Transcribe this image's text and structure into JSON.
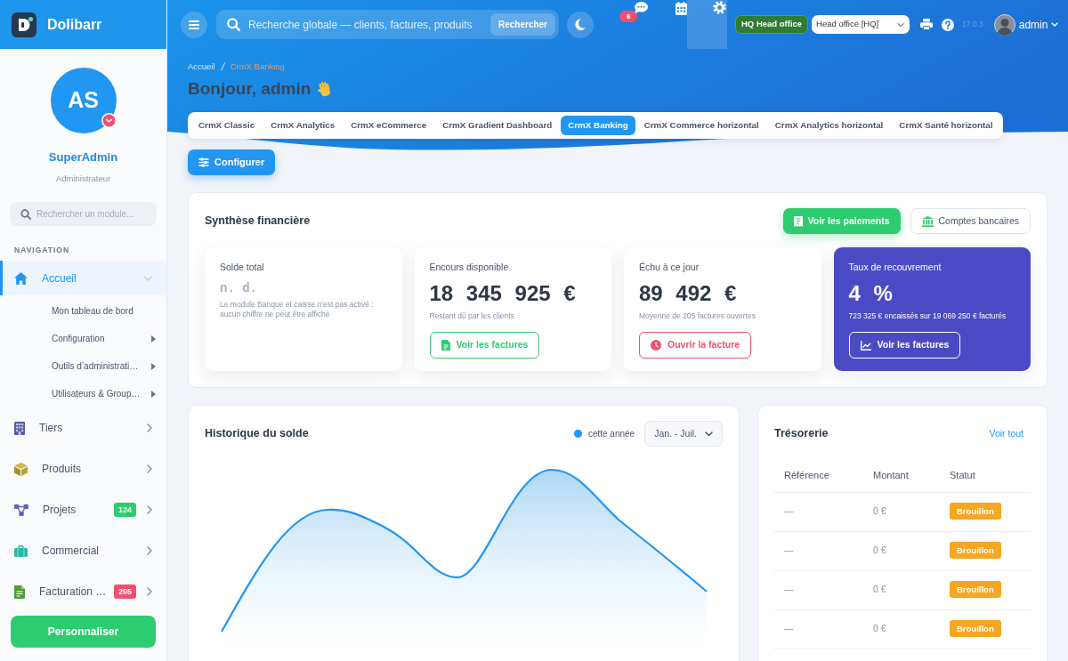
{
  "sidebar": {
    "brand": "Dolibarr",
    "profile": {
      "initials": "AS",
      "name": "SuperAdmin",
      "role": "Administrateur"
    },
    "search": {
      "placeholder": "Rechercher un module..."
    },
    "section": "NAVIGATION",
    "items": [
      {
        "label": "Accueil",
        "selected": true,
        "expanded": true,
        "children": [
          {
            "label": "Mon tableau de bord",
            "submenu": false
          },
          {
            "label": "Configuration",
            "submenu": true
          },
          {
            "label": "Outils d’administrati…",
            "submenu": true
          },
          {
            "label": "Utilisateurs & Group…",
            "submenu": true
          }
        ]
      },
      {
        "label": "Tiers",
        "selected": false,
        "expanded": false
      },
      {
        "label": "Produits",
        "selected": false,
        "expanded": false
      },
      {
        "label": "Projets",
        "selected": false,
        "expanded": false,
        "badge": {
          "text": "124",
          "color": "#2ecc71"
        }
      },
      {
        "label": "Commercial",
        "selected": false,
        "expanded": false
      },
      {
        "label": "Facturation …",
        "selected": false,
        "expanded": false,
        "badge": {
          "text": "205",
          "color": "#f0506e"
        }
      }
    ],
    "button": "Personnaliser"
  },
  "topbar": {
    "search": {
      "placeholder": "Recherche globale — clients, factures, produits",
      "button": "Rechercher"
    },
    "messages_count": "6",
    "entity": "HQ Head office",
    "entity_select": "Head office [HQ]",
    "version": "17.0.3",
    "user": "admin"
  },
  "header": {
    "breadcrumb": [
      "Accueil",
      "CrmX Banking"
    ],
    "greeting": "Bonjour, admin",
    "tabs": [
      {
        "label": "CrmX Classic",
        "selected": false
      },
      {
        "label": "CrmX Analytics",
        "selected": false
      },
      {
        "label": "CrmX eCommerce",
        "selected": false
      },
      {
        "label": "CrmX Gradient Dashboard",
        "selected": false
      },
      {
        "label": "CrmX Banking",
        "selected": true
      },
      {
        "label": "CrmX Commerce horizontal",
        "selected": false
      },
      {
        "label": "CrmX Analytics horizontal",
        "selected": false
      },
      {
        "label": "CrmX Santé horizontal",
        "selected": false
      }
    ],
    "configure_button": "Configurer"
  },
  "financial_summary": {
    "title": "Synthèse financière",
    "actions": [
      {
        "label": "Voir les paiements",
        "kind": "solid"
      },
      {
        "label": "Comptes bancaires",
        "kind": "outline"
      }
    ],
    "cards": [
      {
        "kind": "unavailable",
        "title": "Solde total",
        "value": "n. d.",
        "note": "Le module Banque et caisse n'est pas activé : aucun chiffre ne peut être affiché"
      },
      {
        "kind": "metric",
        "title": "Encours disponible",
        "value": "18 345 925 €",
        "note": "Restant dû par les clients",
        "button": {
          "label": "Voir les factures",
          "color": "#2ecc71"
        }
      },
      {
        "kind": "metric",
        "title": "Échu à ce jour",
        "value": "89 492 €",
        "note": "Moyenne de 205 factures ouvertes",
        "button": {
          "label": "Ouvrir la facture",
          "color": "#f0506e"
        }
      },
      {
        "kind": "featured",
        "title": "Taux de recouvrement",
        "value": "4 %",
        "note": "723 325 € encaissés sur 19 069 250 € facturés",
        "button": {
          "label": "Voir les factures",
          "color": "#ffffff"
        }
      }
    ]
  },
  "balance_history": {
    "title": "Historique du solde",
    "legend": "cette année",
    "period": "Jan. - Juil."
  },
  "treasury": {
    "title": "Trésorerie",
    "link": "Voir tout",
    "columns": [
      "Référence",
      "Montant",
      "Statut"
    ],
    "rows": [
      {
        "reference": "—",
        "amount": "0 €",
        "status": "Brouillon"
      },
      {
        "reference": "—",
        "amount": "0 €",
        "status": "Brouillon"
      },
      {
        "reference": "—",
        "amount": "0 €",
        "status": "Brouillon"
      },
      {
        "reference": "—",
        "amount": "0 €",
        "status": "Brouillon"
      }
    ]
  }
}
